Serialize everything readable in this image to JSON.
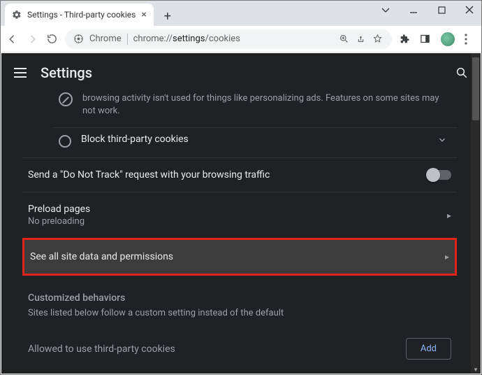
{
  "window": {
    "tab_title": "Settings - Third-party cookies"
  },
  "omnibox": {
    "scheme_label": "Chrome",
    "url_path": "chrome://",
    "url_bold": "settings",
    "url_rest": "/cookies"
  },
  "appbar": {
    "title": "Settings"
  },
  "truncated_option": {
    "desc": "browsing activity isn't used for things like personalizing ads. Features on some sites may not work."
  },
  "block_tp": {
    "title": "Block third-party cookies"
  },
  "dnt": {
    "title": "Send a \"Do Not Track\" request with your browsing traffic",
    "enabled": false
  },
  "preload": {
    "title": "Preload pages",
    "sub": "No preloading"
  },
  "site_data": {
    "title": "See all site data and permissions"
  },
  "custom": {
    "heading": "Customized behaviors",
    "desc": "Sites listed below follow a custom setting instead of the default"
  },
  "allowed": {
    "label": "Allowed to use third-party cookies",
    "add_button": "Add"
  }
}
